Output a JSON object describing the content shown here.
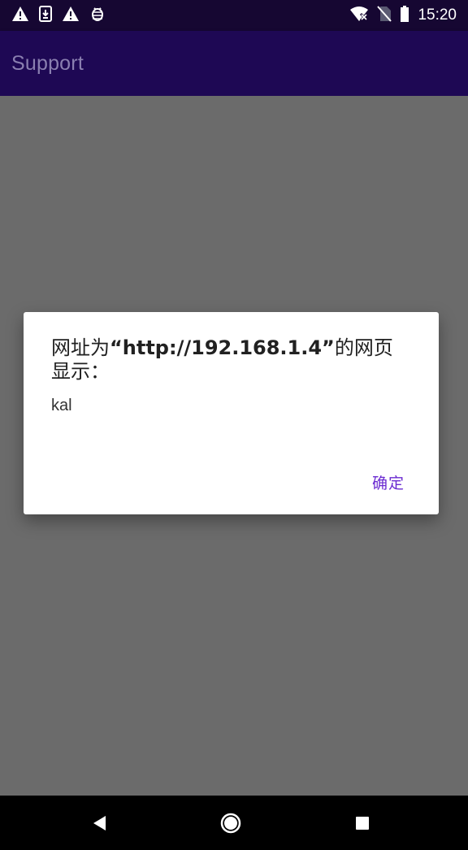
{
  "status_bar": {
    "icons_left": [
      "warning-icon",
      "download-icon",
      "warning-icon",
      "debug-bug-icon"
    ],
    "icons_right": [
      "wifi-off-icon",
      "no-sim-icon",
      "battery-icon"
    ],
    "time": "15:20"
  },
  "app_bar": {
    "title": "Support"
  },
  "dialog": {
    "title_prefix": "网址为",
    "title_url": "“http://192.168.1.4”",
    "title_suffix": "的网页显示：",
    "message": "kal",
    "ok_label": "确定",
    "accent_color": "#6b2bd1"
  },
  "nav_bar": {
    "buttons": [
      "back-icon",
      "home-icon",
      "recents-icon"
    ]
  },
  "colors": {
    "status_bar": "#160732",
    "app_bar": "#1e0854",
    "scrim": "#6b6b6b"
  }
}
